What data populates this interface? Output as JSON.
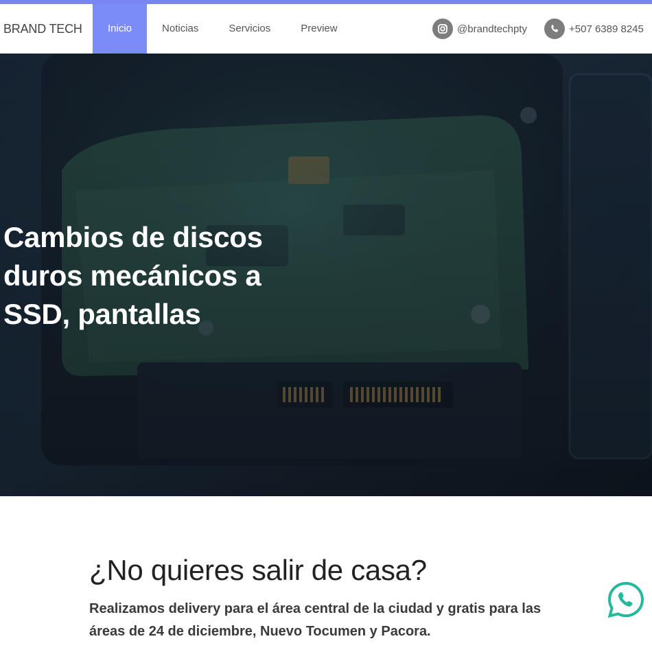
{
  "nav": {
    "brand": "BRAND TECH",
    "items": [
      {
        "label": "Inicio",
        "active": true
      },
      {
        "label": "Noticias",
        "active": false
      },
      {
        "label": "Servicios",
        "active": false
      },
      {
        "label": "Preview",
        "active": false
      }
    ],
    "instagram": {
      "icon": "instagram-icon",
      "label": "@brandtechpty"
    },
    "phone": {
      "icon": "phone-icon",
      "label": "+507 6389 8245"
    }
  },
  "hero": {
    "title": "Cambios de discos duros mecánicos a SSD, pantallas"
  },
  "delivery": {
    "heading": "¿No quieres salir de casa?",
    "text": "Realizamos delivery para el área central de la ciudad y gratis para las áreas de 24 de diciembre, Nuevo Tocumen y Pacora."
  },
  "floating": {
    "icon": "whatsapp-icon"
  },
  "colors": {
    "accent": "#7b8cf8",
    "whatsapp": "#25b89a",
    "icon_circle": "#7d7d7d"
  }
}
